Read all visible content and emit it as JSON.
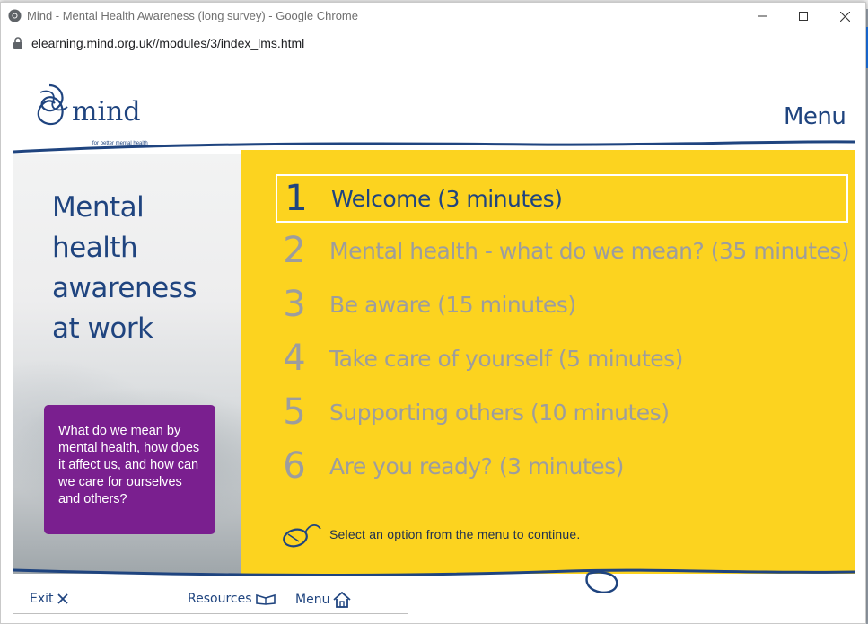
{
  "window": {
    "title": "Mind - Mental Health Awareness (long survey) - Google Chrome",
    "url": "elearning.mind.org.uk//modules/3/index_lms.html"
  },
  "logo": {
    "word": "mind",
    "tagline": "for better mental health"
  },
  "header": {
    "menu_label": "Menu"
  },
  "headline": [
    "Mental",
    "health",
    "awareness",
    "at work"
  ],
  "promo_text": "What do we mean by mental health, how does it affect us, and how can we care for ourselves and others?",
  "modules": [
    {
      "number": "1",
      "label": "Welcome (3 minutes)",
      "active": true
    },
    {
      "number": "2",
      "label": "Mental health - what do we mean? (35 minutes)",
      "active": false
    },
    {
      "number": "3",
      "label": "Be aware (15 minutes)",
      "active": false
    },
    {
      "number": "4",
      "label": "Take care of yourself (5 minutes)",
      "active": false
    },
    {
      "number": "5",
      "label": "Supporting others (10 minutes)",
      "active": false
    },
    {
      "number": "6",
      "label": "Are you ready? (3 minutes)",
      "active": false
    }
  ],
  "instruction": "Select an option from the menu to continue.",
  "footer": {
    "exit": "Exit",
    "resources": "Resources",
    "menu": "Menu"
  },
  "colors": {
    "navy": "#1f447f",
    "yellow": "#fcd31f",
    "purple": "#7a1f8f",
    "inactive": "#9d9d9d"
  },
  "icons": [
    "chrome-icon",
    "minimize-icon",
    "maximize-icon",
    "close-icon",
    "lock-icon",
    "mouse-icon",
    "close-x-icon",
    "book-icon",
    "home-icon"
  ]
}
